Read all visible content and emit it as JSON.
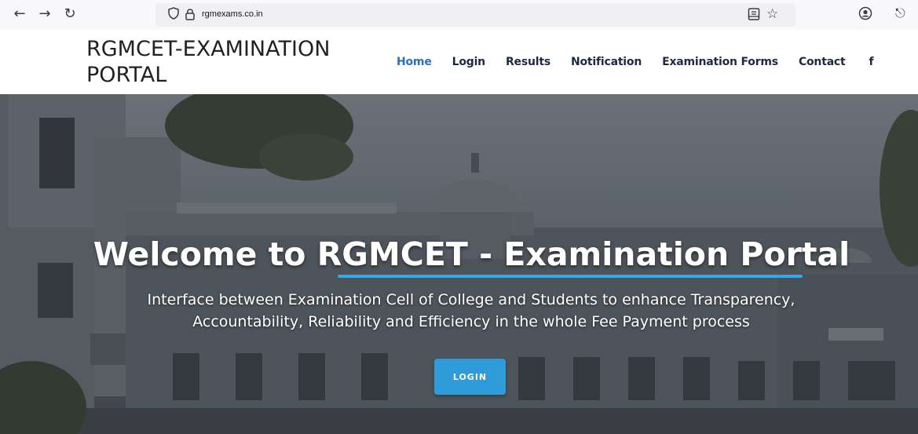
{
  "browser": {
    "url": "rgmexams.co.in",
    "back_icon": "arrow-left-icon",
    "forward_icon": "arrow-right-icon",
    "reload_icon": "reload-icon"
  },
  "site": {
    "title": "RGMCET-EXAMINATION PORTAL",
    "nav": [
      {
        "label": "Home",
        "active": true
      },
      {
        "label": "Login"
      },
      {
        "label": "Results"
      },
      {
        "label": "Notification"
      },
      {
        "label": "Examination Forms"
      },
      {
        "label": "Contact"
      },
      {
        "label": "f"
      }
    ]
  },
  "hero": {
    "title": "Welcome to RGMCET - Examination Portal",
    "subtitle_line1": "Interface between Examination Cell of College and Students to enhance Transparency,",
    "subtitle_line2": "Accountability, Reliability and Efficiency in the whole Fee Payment process",
    "login_label": "LOGIN"
  },
  "colors": {
    "accent": "#2f9bd9",
    "nav_active": "#2c6fc0",
    "underline": "#34a7e6"
  }
}
